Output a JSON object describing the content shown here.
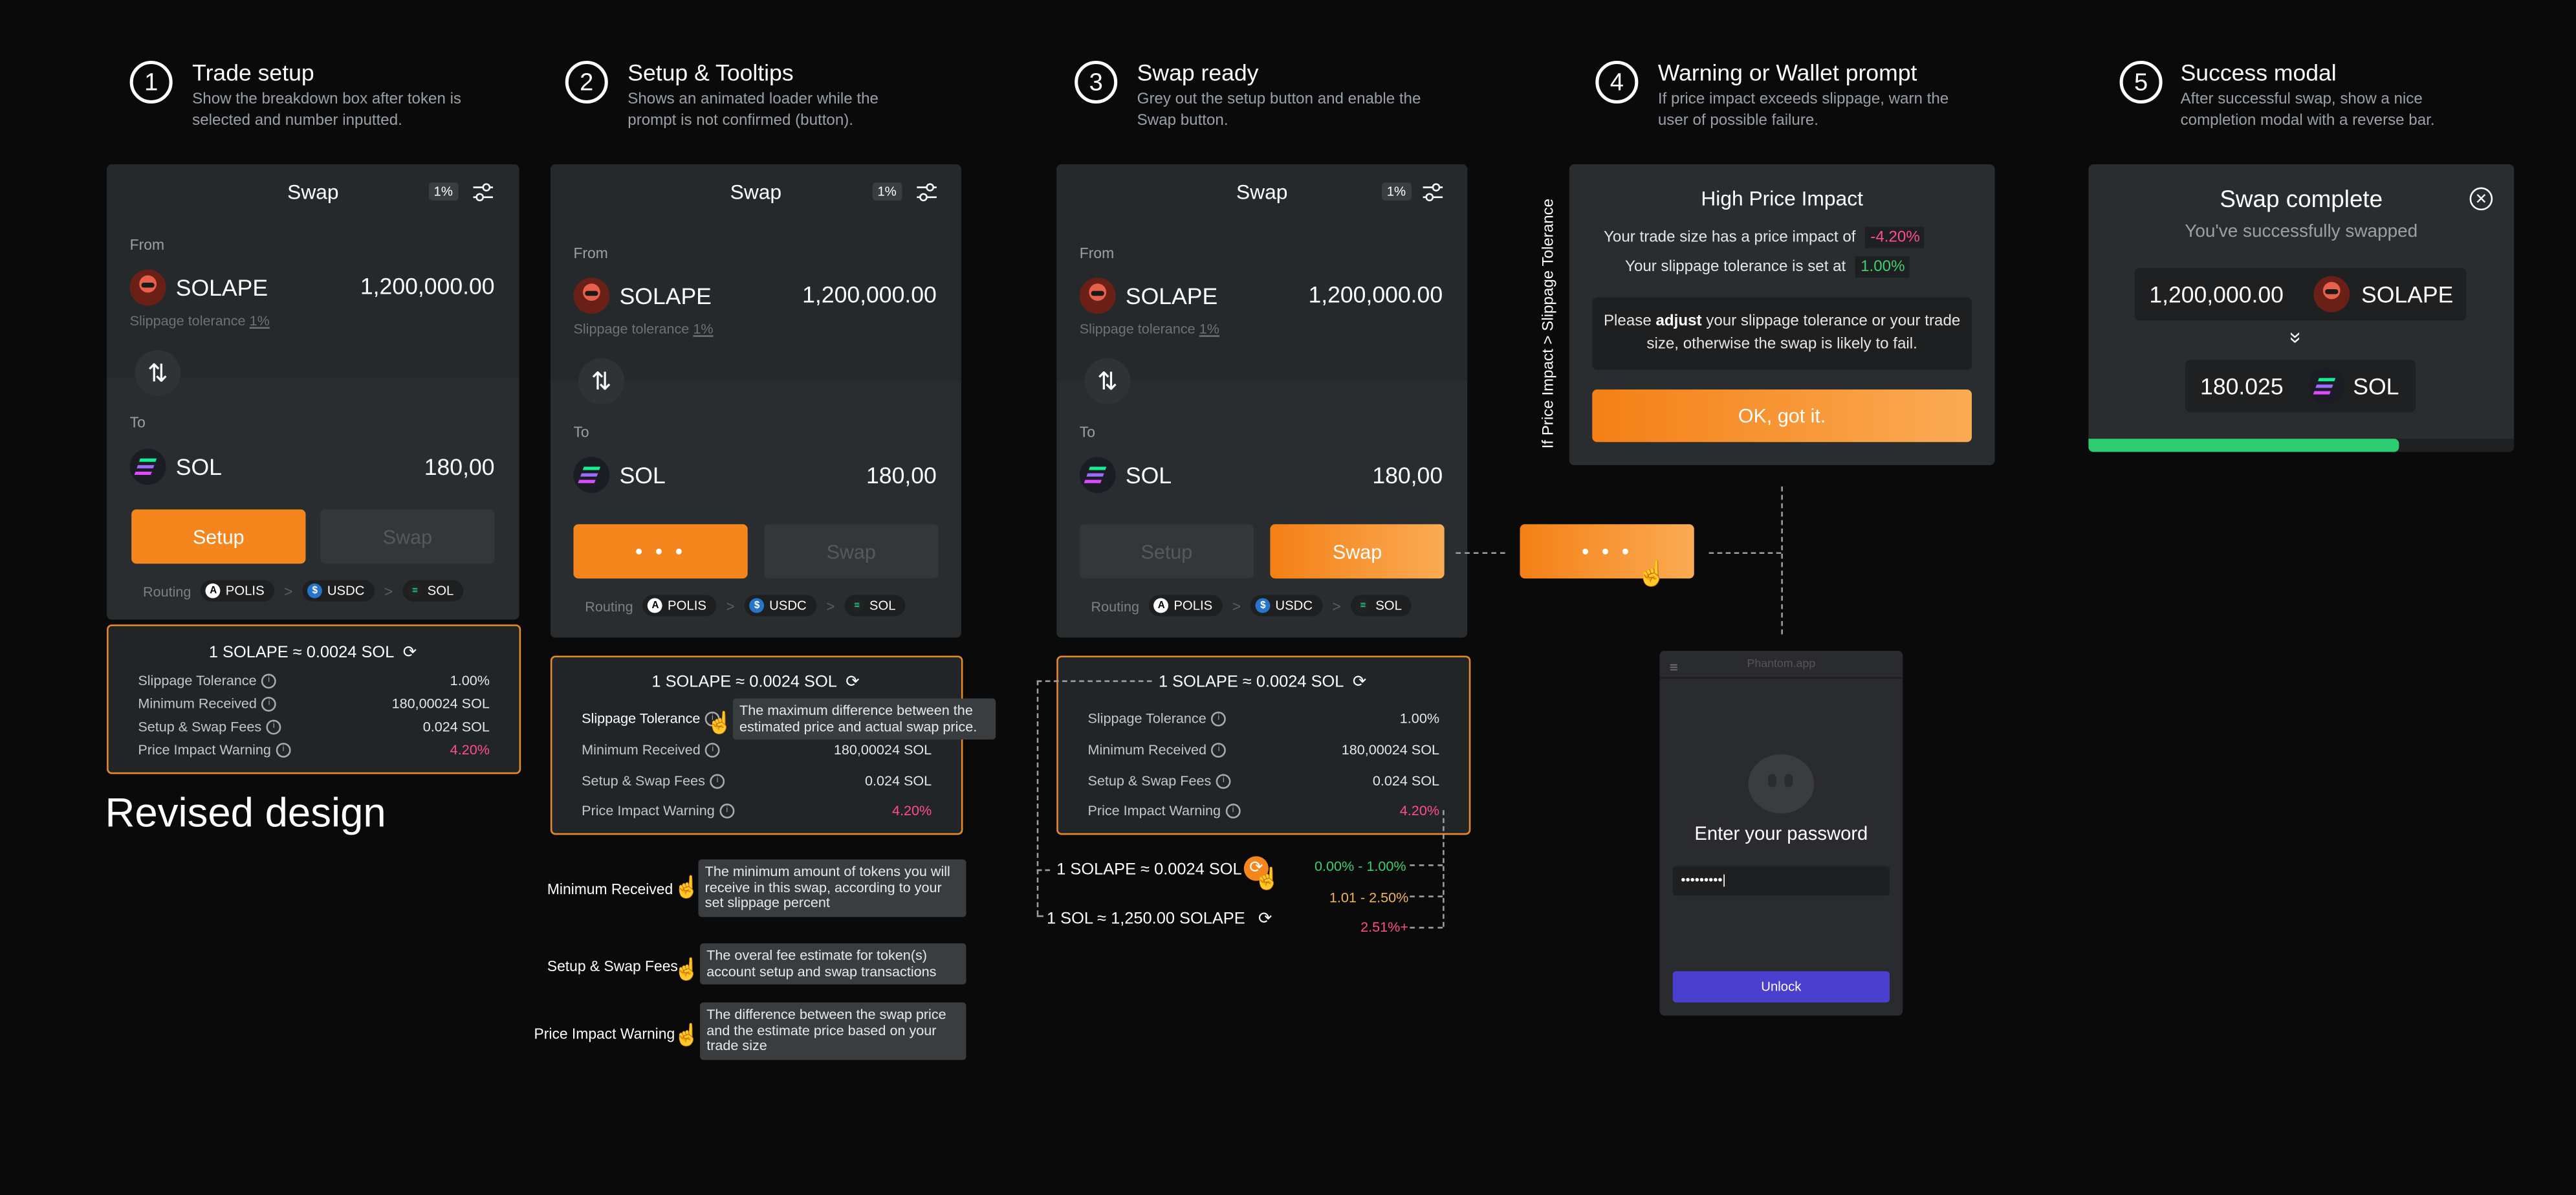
{
  "steps": [
    {
      "number": "1",
      "title": "Trade setup",
      "desc": "Show the breakdown box after token is selected and number inputted."
    },
    {
      "number": "2",
      "title": "Setup & Tooltips",
      "desc": "Shows an animated loader while the prompt is not confirmed (button)."
    },
    {
      "number": "3",
      "title": "Swap ready",
      "desc": "Grey out the setup button and enable the Swap button."
    },
    {
      "number": "4",
      "title": "Warning or Wallet prompt",
      "desc": "If price impact exceeds slippage, warn the user of possible failure."
    },
    {
      "number": "5",
      "title": "Success modal",
      "desc": "After successful swap, show a nice completion modal with a reverse bar."
    }
  ],
  "swap_card": {
    "title": "Swap",
    "tolerance_badge": "1%",
    "from_label": "From",
    "to_label": "To",
    "from_token": "SOLAPE",
    "from_amount": "1,200,000.00",
    "to_token": "SOL",
    "to_amount": "180,00",
    "slippage_label": "Slippage tolerance",
    "slippage_value": "1%",
    "setup_button": "Setup",
    "swap_button": "Swap",
    "loader_dots": "• • •",
    "routing_label": "Routing",
    "route": [
      "POLIS",
      "USDC",
      "SOL"
    ],
    "route_sep": ">"
  },
  "breakdown": {
    "rate": "1 SOLAPE ≈ 0.0024 SOL",
    "rate_reverse": "1 SOL ≈ 1,250.00 SOLAPE",
    "rows": [
      {
        "label": "Slippage Tolerance",
        "value": "1.00%"
      },
      {
        "label": "Minimum Received",
        "value": "180,00024 SOL"
      },
      {
        "label": "Setup & Swap Fees",
        "value": "0.024 SOL"
      },
      {
        "label": "Price Impact Warning",
        "value": "4.20%"
      }
    ]
  },
  "revised_design": "Revised design",
  "tooltips": {
    "slippage": "The maximum difference between the estimated price and actual swap price.",
    "minimum_received_label": "Minimum Received",
    "minimum_received": "The minimum amount of tokens you will receive in this swap, according to your set slippage percent",
    "fees_label": "Setup & Swap Fees",
    "fees": "The overal fee estimate for token(s) account setup and swap transactions",
    "impact_label": "Price Impact Warning",
    "impact": "The difference between the swap price and the estimate price based on your trade size"
  },
  "impact_ranges": [
    {
      "range": "0.00% - 1.00%",
      "color": "#3ecf6e"
    },
    {
      "range": "1.01 - 2.50%",
      "color": "#f0b45a"
    },
    {
      "range": "2.51%+",
      "color": "#ff4d8d"
    }
  ],
  "warning": {
    "side_label": "If Price Impact > Slippage Tolerance",
    "title": "High Price Impact",
    "impact_text": "Your trade size has a price impact of",
    "impact_value": "-4.20%",
    "slippage_text": "Your slippage tolerance is set at",
    "slippage_value": "1.00%",
    "msg_pre": "Please",
    "msg_bold": "adjust",
    "msg_post": "your slippage tolerance or your trade size, otherwise the swap is likely to fail.",
    "ok_button": "OK, got it."
  },
  "wallet": {
    "header": "Phantom.app",
    "prompt": "Enter your password",
    "password_mask": "•••••••••|",
    "unlock_button": "Unlock"
  },
  "success": {
    "title": "Swap complete",
    "subtitle": "You've successfully swapped",
    "from_amount": "1,200,000.00",
    "from_token": "SOLAPE",
    "to_amount": "180.025",
    "to_token": "SOL",
    "arrow": "»",
    "progress": 0.73
  },
  "colors": {
    "orange": "#f4861d",
    "pink": "#ff4d8d",
    "green": "#2ecc71",
    "unlock": "#4a3fcf"
  }
}
